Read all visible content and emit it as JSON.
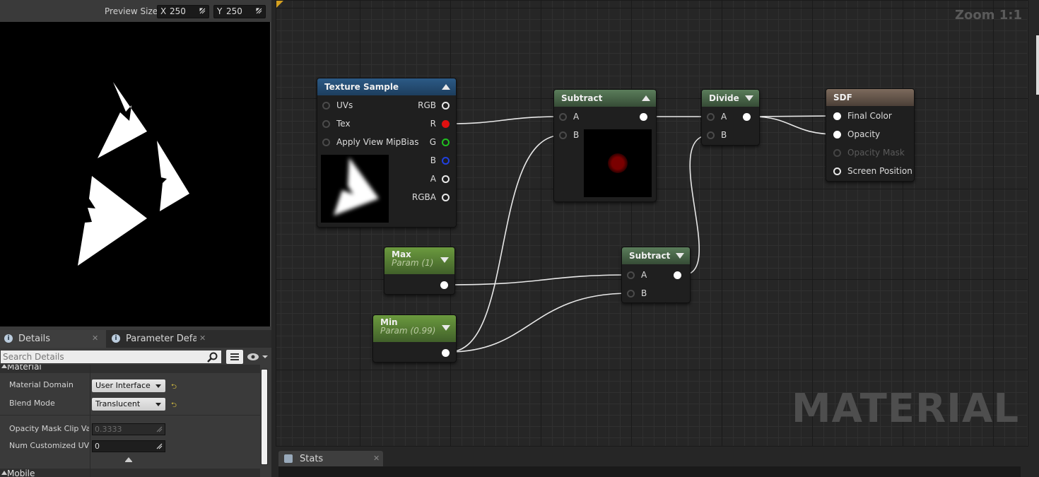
{
  "preview_toolbar": {
    "label": "Preview Size",
    "x_axis": "X",
    "x_value": "250",
    "y_axis": "Y",
    "y_value": "250"
  },
  "details": {
    "tabs": [
      {
        "label": "Details",
        "icon": "info-icon"
      },
      {
        "label": "Parameter Defaults",
        "icon": "info-icon"
      }
    ],
    "search_placeholder": "Search Details",
    "categories": [
      {
        "name": "Material"
      },
      {
        "name": "Mobile"
      }
    ],
    "properties": [
      {
        "name": "Material Domain",
        "value": "User Interface",
        "kind": "combo"
      },
      {
        "name": "Blend Mode",
        "value": "Translucent",
        "kind": "combo"
      },
      {
        "name": "Opacity Mask Clip Value",
        "value": "0.3333",
        "kind": "number-disabled"
      },
      {
        "name": "Num Customized UVs",
        "value": "0",
        "kind": "number"
      }
    ]
  },
  "graph": {
    "zoom": "Zoom 1:1",
    "watermark": "MATERIAL",
    "nodes": {
      "texture_sample": {
        "title": "Texture Sample",
        "inputs": [
          "UVs",
          "Tex",
          "Apply View MipBias"
        ],
        "outputs": [
          "RGB",
          "R",
          "G",
          "B",
          "A",
          "RGBA"
        ]
      },
      "subtract1": {
        "title": "Subtract",
        "inputs": [
          "A",
          "B"
        ]
      },
      "divide": {
        "title": "Divide",
        "inputs": [
          "A",
          "B"
        ]
      },
      "sdf": {
        "title": "SDF",
        "inputs": [
          "Final Color",
          "Opacity",
          "Opacity Mask",
          "Screen Position"
        ]
      },
      "max": {
        "title": "Max",
        "subtitle": "Param (1)"
      },
      "min": {
        "title": "Min",
        "subtitle": "Param (0.99)"
      },
      "subtract2": {
        "title": "Subtract",
        "inputs": [
          "A",
          "B"
        ]
      }
    }
  },
  "stats": {
    "tab_label": "Stats"
  },
  "colors": {
    "accent_corner": "#d4a020",
    "pin_red": "#e01010",
    "pin_green": "#20c020",
    "pin_blue": "#2040e0"
  }
}
